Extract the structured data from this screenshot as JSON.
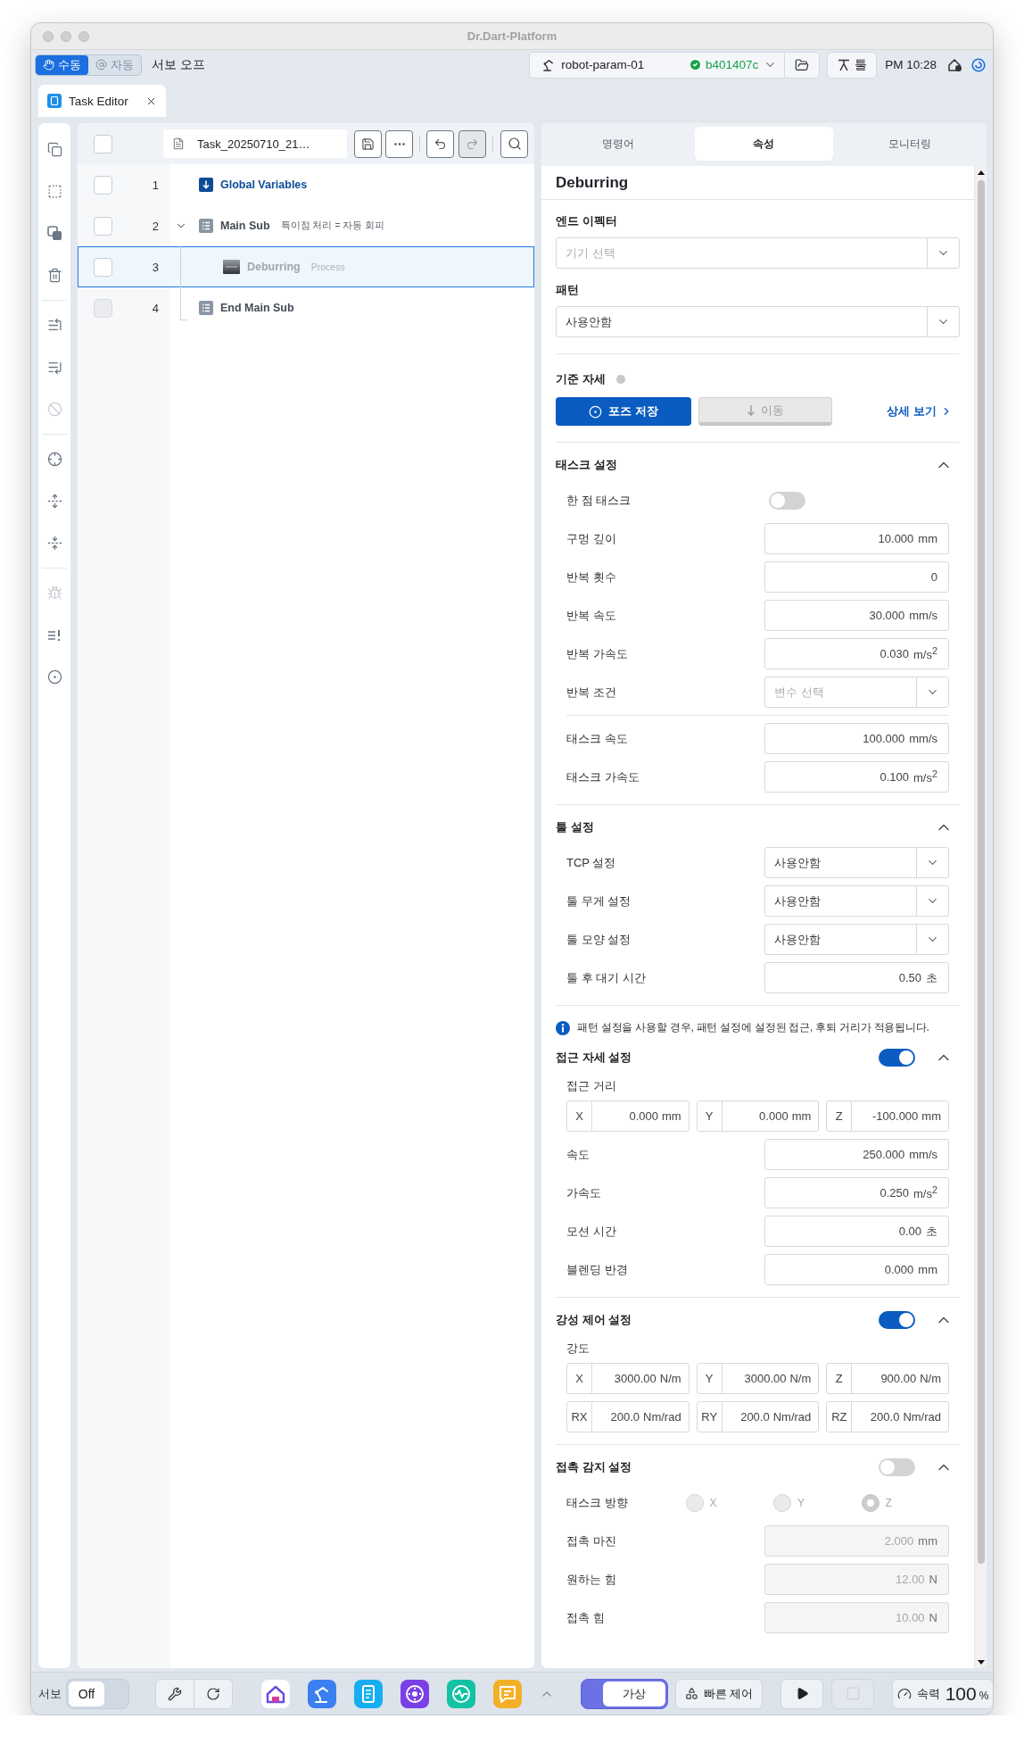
{
  "window": {
    "title": "Dr.Dart-Platform"
  },
  "top_bar": {
    "modes": [
      {
        "label": "수동",
        "selected": true
      },
      {
        "label": "자동",
        "selected": false
      }
    ],
    "servo_status": "서보 오프",
    "robot": {
      "name": "robot-param-01",
      "version": "b401407c"
    },
    "tool_button": "툴",
    "time": "PM 10:28"
  },
  "doc_tabs": [
    {
      "label": "Task Editor",
      "selected": true
    }
  ],
  "sidebar": {
    "groups": [
      [
        {
          "kind": "copy",
          "disabled": false
        },
        {
          "kind": "copy_dashed",
          "disabled": false
        },
        {
          "kind": "duplicate",
          "disabled": false
        },
        {
          "kind": "delete",
          "disabled": false
        }
      ],
      [
        {
          "kind": "indent",
          "disabled": false
        },
        {
          "kind": "outdent",
          "disabled": false
        },
        {
          "kind": "disable",
          "disabled": true
        }
      ],
      [
        {
          "kind": "target",
          "disabled": false
        },
        {
          "kind": "expand",
          "disabled": false
        },
        {
          "kind": "collapse",
          "disabled": false
        }
      ],
      [
        {
          "kind": "debug",
          "disabled": true
        },
        {
          "kind": "alert_list",
          "disabled": false
        },
        {
          "kind": "record",
          "disabled": false
        }
      ]
    ]
  },
  "editor": {
    "select_all": {
      "checked": false
    },
    "file_name": "Task_20250710_21…",
    "history": [
      {
        "kind": "undo",
        "disabled": false
      },
      {
        "kind": "redo",
        "disabled": true
      }
    ],
    "rows": [
      {
        "number": "1",
        "kind": "variables",
        "label": "Global Variables",
        "checked": false,
        "disabled": false,
        "selected": false
      },
      {
        "number": "2",
        "kind": "sub",
        "label": "Main Sub",
        "note": "특이점 처리 = 자동 회피",
        "checked": false,
        "disabled": false,
        "selected": false,
        "expanded": true,
        "children": [
          {
            "number": "3",
            "kind": "process",
            "label": "Deburring",
            "note": "Process",
            "checked": false,
            "disabled": false,
            "selected": true
          }
        ],
        "end": {
          "number": "4",
          "kind": "sub_end",
          "label": "End Main Sub",
          "checked": false,
          "disabled": true,
          "selected": false
        }
      }
    ]
  },
  "panel_tabs": [
    {
      "label": "명령어",
      "selected": false
    },
    {
      "label": "속성",
      "selected": true
    },
    {
      "label": "모니터링",
      "selected": false
    }
  ],
  "properties": {
    "title": "Deburring",
    "end_effector": {
      "label": "엔드 이펙터",
      "placeholder": "기기 선택"
    },
    "pattern": {
      "label": "패턴",
      "value": "사용안함"
    },
    "reference_pose": {
      "label": "기준 자세",
      "saved": false,
      "save_button": "포즈 저장",
      "move_button": "이동",
      "move_disabled": true,
      "detail_link": "상세 보기"
    },
    "sections": [
      {
        "title": "태스크 설정",
        "expanded": true,
        "groups": [
          [
            {
              "kind": "toggle",
              "label": "한 점 태스크",
              "on": false
            },
            {
              "kind": "number",
              "label": "구멍 깊이",
              "value": "10.000",
              "unit": "mm"
            },
            {
              "kind": "number",
              "label": "반복 횟수",
              "value": "0"
            },
            {
              "kind": "number",
              "label": "반복 속도",
              "value": "30.000",
              "unit": "mm/s"
            },
            {
              "kind": "number",
              "label": "반복 가속도",
              "value": "0.030",
              "unit": "m/s$^{2}$"
            },
            {
              "kind": "select",
              "label": "반복 조건",
              "placeholder": "변수 선택"
            }
          ],
          [
            {
              "kind": "number",
              "label": "태스크 속도",
              "value": "100.000",
              "unit": "mm/s"
            },
            {
              "kind": "number",
              "label": "태스크 가속도",
              "value": "0.100",
              "unit": "m/s$^{2}$"
            }
          ]
        ]
      },
      {
        "title": "툴 설정",
        "expanded": true,
        "groups": [
          [
            {
              "kind": "select",
              "label": "TCP 설정",
              "value": "사용안함"
            },
            {
              "kind": "select",
              "label": "툴 무게 설정",
              "value": "사용안함"
            },
            {
              "kind": "select",
              "label": "툴 모양 설정",
              "value": "사용안함"
            },
            {
              "kind": "number",
              "label": "툴 후 대기 시간",
              "value": "0.50",
              "unit": "초"
            }
          ]
        ]
      },
      {
        "notice": "패턴 설정을 사용할 경우, 패턴 설정에 설정된 접근, 후퇴 거리가 적용됩니다.",
        "title": "접근 자세 설정",
        "on": true,
        "expanded": true,
        "groups": [
          [
            {
              "kind": "axes",
              "label": "접근 거리",
              "axes": [
                {
                  "axis": "X",
                  "value": "0.000",
                  "unit": "mm"
                },
                {
                  "axis": "Y",
                  "value": "0.000",
                  "unit": "mm"
                },
                {
                  "axis": "Z",
                  "value": "-100.000",
                  "unit": "mm"
                }
              ]
            },
            {
              "kind": "number",
              "label": "속도",
              "value": "250.000",
              "unit": "mm/s"
            },
            {
              "kind": "number",
              "label": "가속도",
              "value": "0.250",
              "unit": "m/s$^{2}$"
            },
            {
              "kind": "number",
              "label": "모션 시간",
              "value": "0.00",
              "unit": "초"
            },
            {
              "kind": "number",
              "label": "블렌딩 반경",
              "value": "0.000",
              "unit": "mm"
            }
          ]
        ]
      },
      {
        "title": "강성 제어 설정",
        "on": true,
        "expanded": true,
        "groups": [
          [
            {
              "kind": "axes",
              "label": "강도",
              "axes": [
                {
                  "axis": "X",
                  "value": "3000.00",
                  "unit": "N/m"
                },
                {
                  "axis": "Y",
                  "value": "3000.00",
                  "unit": "N/m"
                },
                {
                  "axis": "Z",
                  "value": "900.00",
                  "unit": "N/m"
                },
                {
                  "axis": "RX",
                  "value": "200.0",
                  "unit": "Nm/rad"
                },
                {
                  "axis": "RY",
                  "value": "200.0",
                  "unit": "Nm/rad"
                },
                {
                  "axis": "RZ",
                  "value": "200.0",
                  "unit": "Nm/rad"
                }
              ]
            }
          ]
        ]
      },
      {
        "title": "접촉 감지 설정",
        "on": false,
        "expanded": true,
        "groups": [
          [
            {
              "kind": "radio",
              "label": "태스크 방향",
              "disabled": true,
              "options": [
                {
                  "label": "X",
                  "selected": false
                },
                {
                  "label": "Y",
                  "selected": false
                },
                {
                  "label": "Z",
                  "selected": true
                }
              ]
            },
            {
              "kind": "number",
              "label": "접촉 마진",
              "value": "2.000",
              "unit": "mm",
              "disabled": true
            },
            {
              "kind": "number",
              "label": "원하는 힘",
              "value": "12.00",
              "unit": "N",
              "disabled": true
            },
            {
              "kind": "number",
              "label": "접촉 힘",
              "value": "10.00",
              "unit": "N",
              "disabled": true
            }
          ]
        ]
      }
    ]
  },
  "bottom_bar": {
    "servo": {
      "label": "서보",
      "state": "Off",
      "on": false
    },
    "virtual_mode": {
      "label": "가상",
      "on": true
    },
    "quick_control": "빠른 제어",
    "transport": [
      {
        "kind": "play",
        "disabled": false
      },
      {
        "kind": "stop",
        "disabled": true
      }
    ],
    "speed": {
      "label": "속력",
      "value": "100",
      "unit": "%"
    }
  }
}
